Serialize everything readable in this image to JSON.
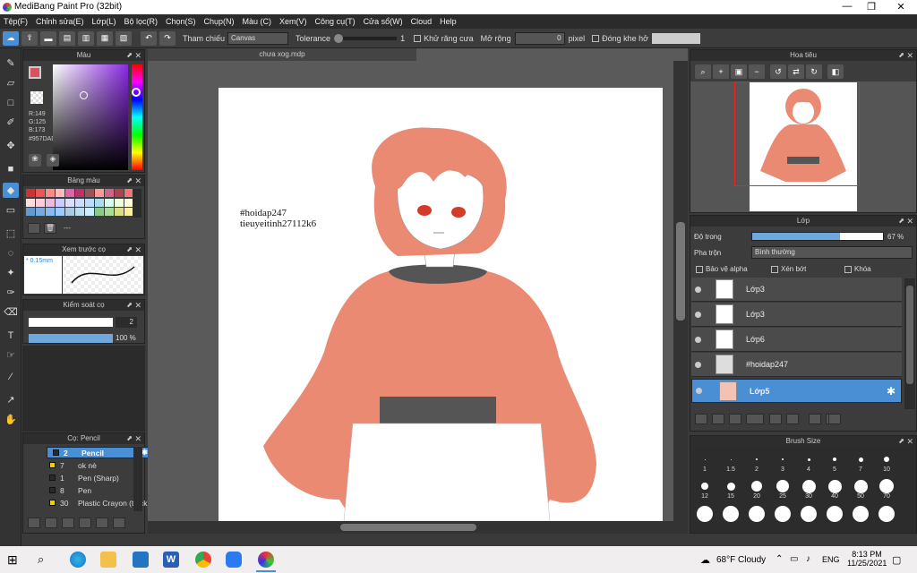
{
  "window": {
    "title": "MediBang Paint Pro (32bit)",
    "minimize": "—",
    "maximize": "❐",
    "close": "✕"
  },
  "menu": [
    "Tệp(F)",
    "Chỉnh sửa(E)",
    "Lớp(L)",
    "Bộ lọc(R)",
    "Chọn(S)",
    "Chụp(N)",
    "Màu (C)",
    "Xem(V)",
    "Công cụ(T)",
    "Cửa sổ(W)",
    "Cloud",
    "Help"
  ],
  "toolbar": {
    "reference_label": "Tham chiếu",
    "reference_value": "Canvas",
    "tolerance_label": "Tolerance",
    "tolerance_value": "1",
    "antialias_label": "Khử răng cưa",
    "expand_label": "Mở rộng",
    "expand_value": "0",
    "expand_unit": "pixel",
    "gap_label": "Đóng khe hở"
  },
  "color_panel": {
    "title": "Màu",
    "r": "R:149",
    "g": "G:125",
    "b": "B:173",
    "hex": "#957DAD",
    "current_color": "#d9505f"
  },
  "palette_panel": {
    "title": "Bảng màu",
    "extra": "---"
  },
  "preview_panel": {
    "title": "Xem trước cọ",
    "size": "* 0.15mm"
  },
  "brush_control": {
    "title": "Kiểm soát cọ",
    "size_value": "2",
    "opacity_value": "100 %",
    "opacity_fraction": 1.0
  },
  "brush_panel": {
    "title": "Cọ: Pencil",
    "items": [
      {
        "size": "2",
        "name": "Pencil",
        "color": "#2a2a2a",
        "selected": true
      },
      {
        "size": "7",
        "name": "ok nè",
        "color": "#f0d000",
        "selected": false
      },
      {
        "size": "1",
        "name": "Pen (Sharp)",
        "color": "#2a2a2a",
        "selected": false
      },
      {
        "size": "8",
        "name": "Pen",
        "color": "#2a2a2a",
        "selected": false
      },
      {
        "size": "30",
        "name": "Plastic Crayon (thick)",
        "color": "#f0d000",
        "selected": false
      }
    ]
  },
  "document": {
    "tab": "chưa xog.mdp",
    "text_line1": "#hoidap247",
    "text_line2": "tieuyeitinh27112k6"
  },
  "navigator": {
    "title": "Hoa tiêu"
  },
  "layer_panel": {
    "title": "Lớp",
    "opacity_label": "Độ trong",
    "opacity_value": "67 %",
    "opacity_fraction": 0.67,
    "blend_label": "Pha trộn",
    "blend_value": "Bình thường",
    "protect_alpha": "Bảo vệ alpha",
    "clip": "Xén bớt",
    "lock": "Khóa",
    "layers": [
      {
        "name": "Lớp3",
        "selected": false
      },
      {
        "name": "Lớp3",
        "selected": false
      },
      {
        "name": "Lớp6",
        "selected": false
      },
      {
        "name": "#hoidap247",
        "selected": false
      },
      {
        "name": "Lớp5",
        "selected": true
      }
    ]
  },
  "brush_size_panel": {
    "title": "Brush Size",
    "row1": [
      "1",
      "1.5",
      "2",
      "3",
      "4",
      "5",
      "7",
      "10"
    ],
    "row2": [
      "12",
      "15",
      "20",
      "25",
      "30",
      "40",
      "50",
      "70"
    ]
  },
  "taskbar": {
    "weather": "68°F  Cloudy",
    "lang": "ENG",
    "time": "8:13 PM",
    "date": "11/25/2021"
  }
}
